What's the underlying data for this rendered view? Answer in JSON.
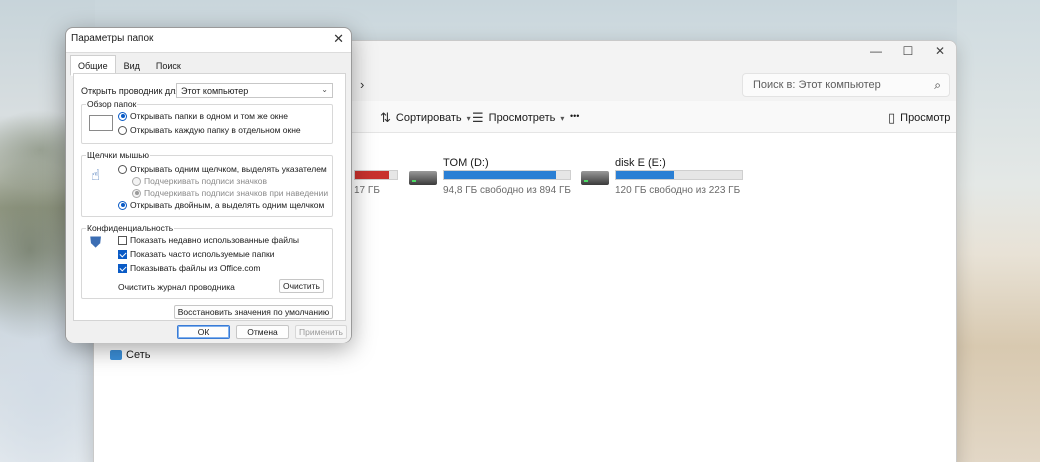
{
  "explorer": {
    "search_placeholder": "Поиск в: Этот компьютер",
    "address_chevron": "›",
    "window_controls": {
      "minimize": "—",
      "maximize": "☐",
      "close": "✕"
    },
    "toolbar": {
      "sort_label": "Сортировать",
      "view_label": "Просмотреть",
      "more_label": "•••",
      "preview_label": "Просмотр"
    },
    "drives": [
      {
        "name": "",
        "free_text": "17 ГБ",
        "fill": 0.82,
        "full": true
      },
      {
        "name": "TOM (D:)",
        "free_text": "94,8 ГБ свободно из 894 ГБ",
        "fill": 0.89,
        "full": false
      },
      {
        "name": "disk E (E:)",
        "free_text": "120 ГБ свободно из 223 ГБ",
        "fill": 0.46,
        "full": false
      }
    ],
    "network_label": "Сеть"
  },
  "dialog": {
    "title": "Параметры папок",
    "close_glyph": "✕",
    "tabs": [
      {
        "label": "Общие",
        "active": true
      },
      {
        "label": "Вид",
        "active": false
      },
      {
        "label": "Поиск",
        "active": false
      }
    ],
    "open_explorer_label": "Открыть проводник для:",
    "open_explorer_value": "Этот компьютер",
    "browse_group": {
      "title": "Обзор папок",
      "options": [
        {
          "label": "Открывать папки в одном и том же окне",
          "selected": true
        },
        {
          "label": "Открывать каждую папку в отдельном окне",
          "selected": false
        }
      ]
    },
    "click_group": {
      "title": "Щелчки мышью",
      "single_click": "Открывать одним щелчком, выделять указателем",
      "underline_always": "Подчеркивать подписи значков",
      "underline_hover": "Подчеркивать подписи значков при наведении",
      "double_click": "Открывать двойным, а выделять одним щелчком"
    },
    "privacy_group": {
      "title": "Конфиденциальность",
      "checks": [
        {
          "label": "Показать недавно использованные файлы",
          "checked": false
        },
        {
          "label": "Показать часто используемые папки",
          "checked": true
        },
        {
          "label": "Показывать файлы из Office.com",
          "checked": true
        }
      ],
      "clear_label": "Очистить журнал проводника",
      "clear_button": "Очистить"
    },
    "restore_button": "Восстановить значения по умолчанию",
    "ok_button": "ОК",
    "cancel_button": "Отмена",
    "apply_button": "Применить"
  }
}
